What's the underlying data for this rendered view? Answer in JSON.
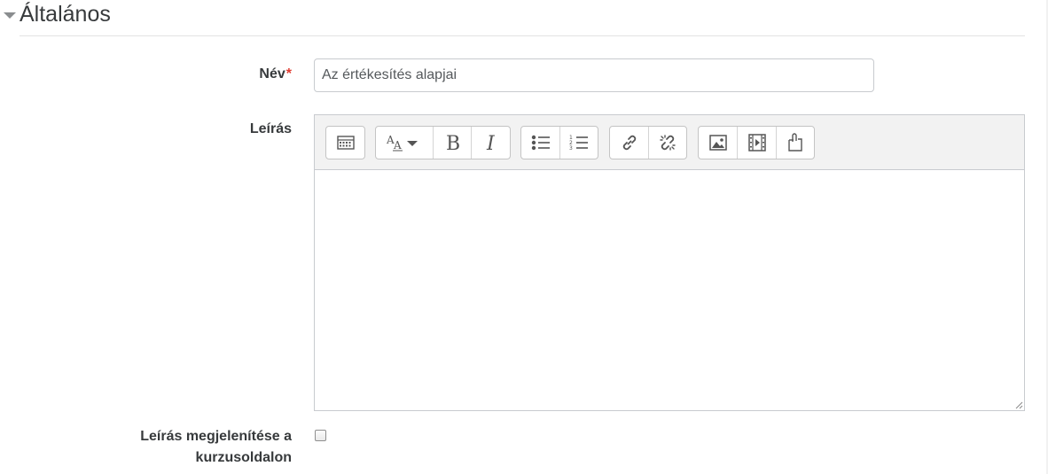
{
  "section": {
    "title": "Általános"
  },
  "fields": {
    "name": {
      "label": "Név",
      "required_mark": "*",
      "value": "Az értékesítés alapjai"
    },
    "description": {
      "label": "Leírás",
      "content": ""
    },
    "show_description": {
      "label_line1": "Leírás megjelenítése a",
      "label_line2": "kurzusoldalon",
      "checked": false
    }
  },
  "toolbar": {
    "groups": [
      [
        "toolbar-toggle-icon"
      ],
      [
        "font-style-icon",
        "bold-icon",
        "italic-icon"
      ],
      [
        "unordered-list-icon",
        "ordered-list-icon"
      ],
      [
        "link-icon",
        "unlink-icon"
      ],
      [
        "image-icon",
        "media-icon",
        "file-manager-icon"
      ]
    ]
  },
  "colors": {
    "required": "#e03c31",
    "toolbar_bg": "#f2f2f2",
    "border": "#c8cbcf"
  }
}
